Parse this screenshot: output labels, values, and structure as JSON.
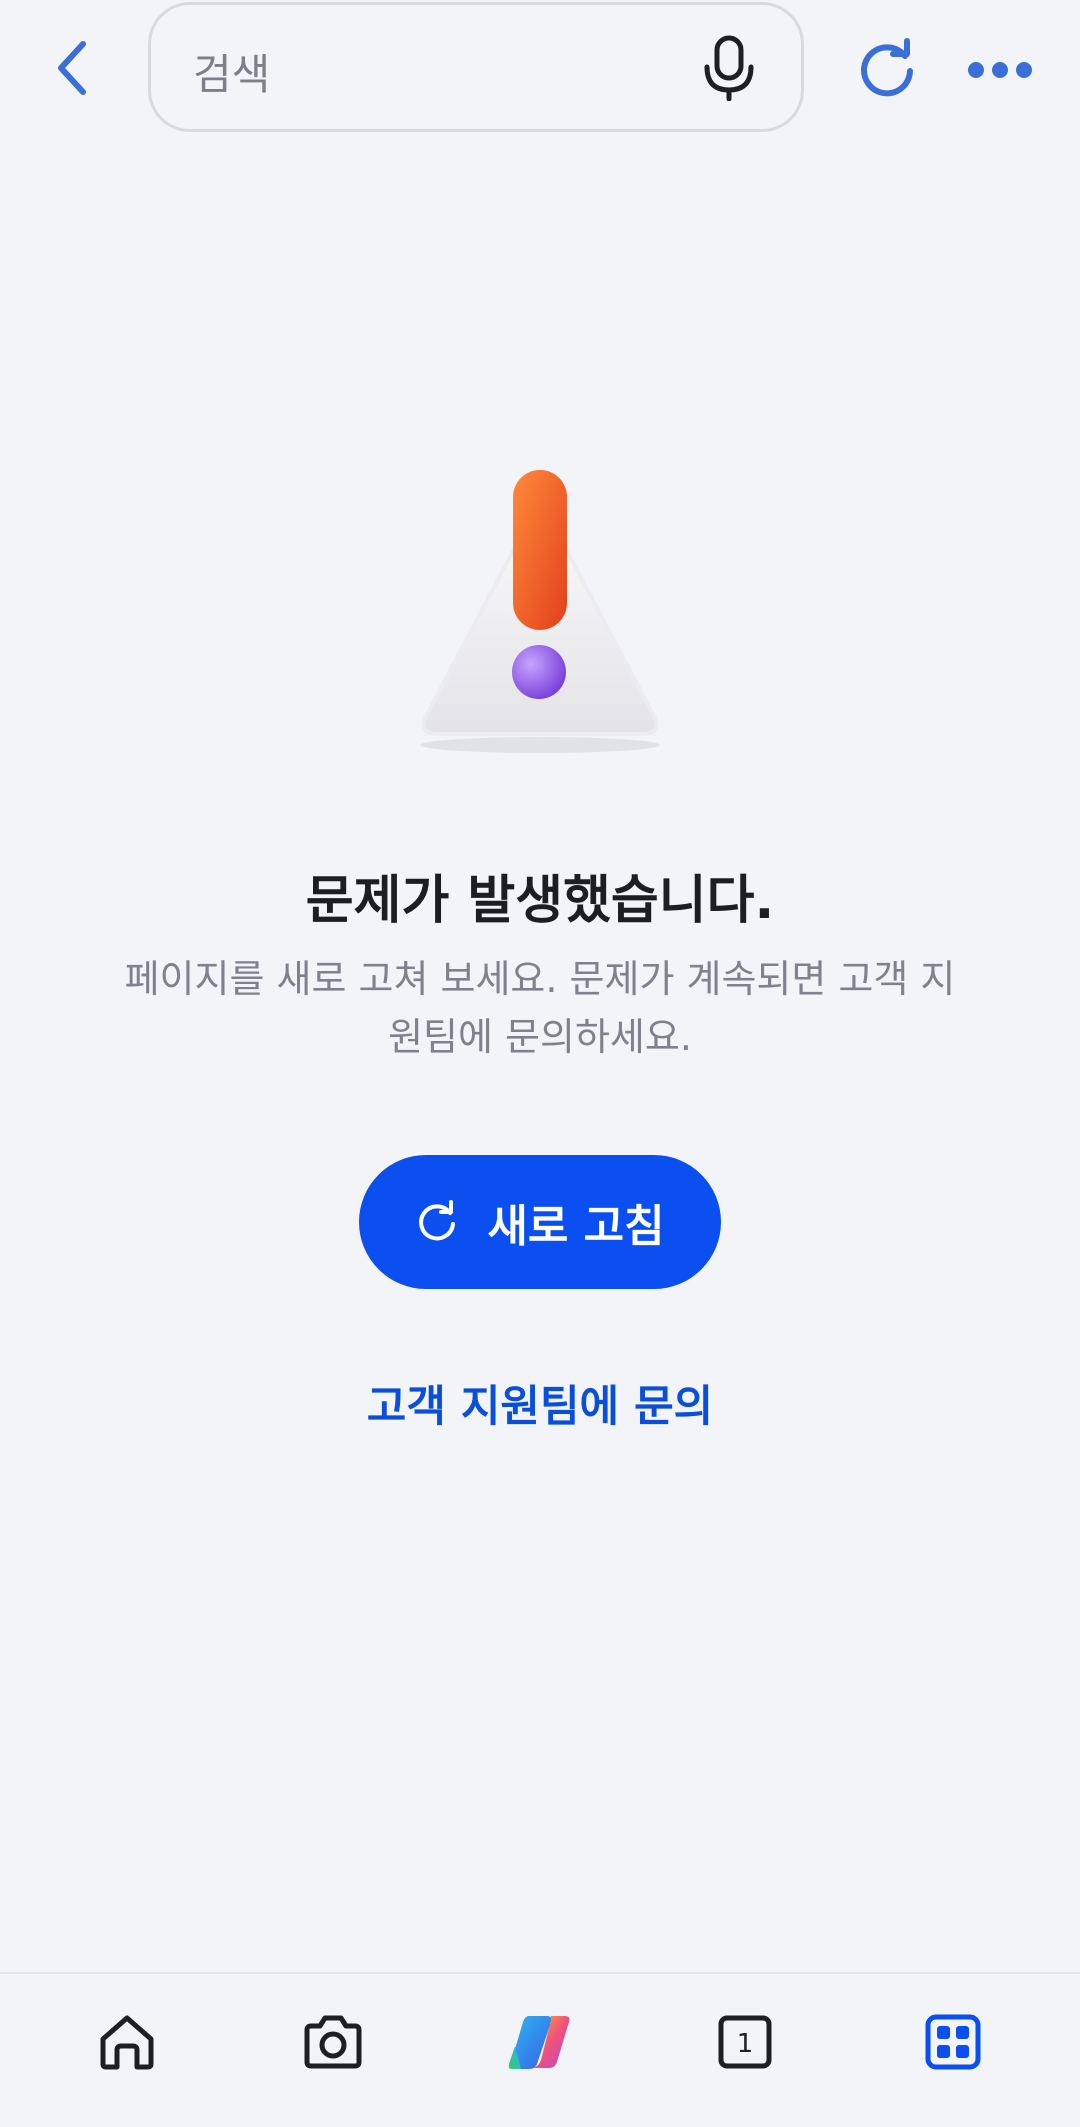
{
  "top_bar": {
    "search_placeholder": "검색",
    "back_icon": "chevron-left-icon",
    "mic_icon": "microphone-icon",
    "reload_icon": "reload-icon",
    "more_icon": "more-horizontal-icon"
  },
  "error": {
    "title": "문제가 발생했습니다.",
    "description": "페이지를 새로 고쳐 보세요. 문제가 계속되면 고객 지원팀에 문의하세요.",
    "refresh_button_label": "새로 고침",
    "support_link_label": "고객 지원팀에 문의"
  },
  "bottom_nav": {
    "tab_count": "1",
    "items": [
      "home-icon",
      "camera-icon",
      "copilot-icon",
      "tabs-icon",
      "apps-icon"
    ]
  },
  "colors": {
    "accent": "#0b4ff0",
    "link": "#0b4fd9",
    "icon_blue": "#3b6fd8",
    "background": "#f3f4f8"
  }
}
